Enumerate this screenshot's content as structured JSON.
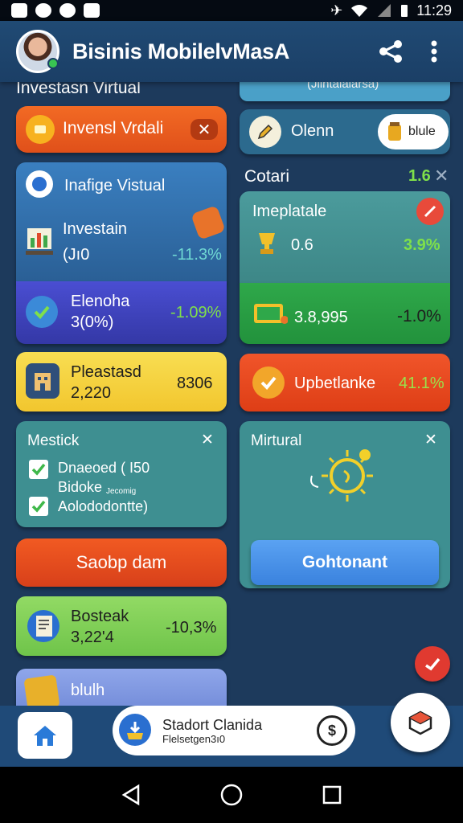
{
  "status_bar": {
    "time": "11:29"
  },
  "app_bar": {
    "title": "Bisinis MobilelvMasA"
  },
  "left": {
    "section_label": "Investasn Virtual",
    "banner": {
      "label": "Invensl Vrdali",
      "close": "✕"
    },
    "card_blue": {
      "title": "Inafige Vistual",
      "row": {
        "label": "Investain",
        "sub": "(Jı0",
        "value": "-11.3%"
      }
    },
    "card_purple": {
      "label": "Elenoha",
      "sub": "3(0%)",
      "value": "-1.09%"
    },
    "card_yellow": {
      "label": "Pleastasd",
      "sub": "2,220",
      "value": "8306"
    },
    "checklist": {
      "title": "Mestick",
      "close": "✕",
      "items": [
        {
          "text": "Dnaeoed ( I50"
        },
        {
          "text": "Bidoke"
        },
        {
          "text": "Aolododontte)"
        }
      ],
      "tiny_note": "Jecomig"
    },
    "button_red": {
      "label": "Saobp dam"
    },
    "card_green": {
      "label": "Bosteak",
      "sub": "3,22'4",
      "value": "-10,3%"
    },
    "card_periwinkle": {
      "label": "blulh"
    }
  },
  "right": {
    "top_card_text": "(Jlihtalalarsa)",
    "search_row": {
      "label": "Olenn",
      "badge": "blule"
    },
    "section": {
      "label": "Cotari",
      "count": "1.6"
    },
    "card_teal": {
      "title": "Imeplatale",
      "row_value": "0.6",
      "row_change": "3.9%"
    },
    "card_green": {
      "value": "3.8,995",
      "change": "-1.0%"
    },
    "card_red": {
      "label": "Upbetlanke",
      "change": "41.1%"
    },
    "virtual_card": {
      "title": "Mirtural",
      "close": "✕",
      "button": "Gohtonant"
    }
  },
  "bottom_bar": {
    "pill_title": "Stadort Clanida",
    "pill_sub": "Flelsetgen3ı0"
  },
  "colors": {
    "orange": "#ee5a1c",
    "blue_card": "#2e6ea8",
    "purple": "#3b3fb8",
    "yellow": "#f6d440",
    "teal": "#3e8f91",
    "red": "#e84418",
    "green_card": "#7fd056",
    "periwinkle": "#7d96e0",
    "accent_green": "#7fe04a"
  }
}
